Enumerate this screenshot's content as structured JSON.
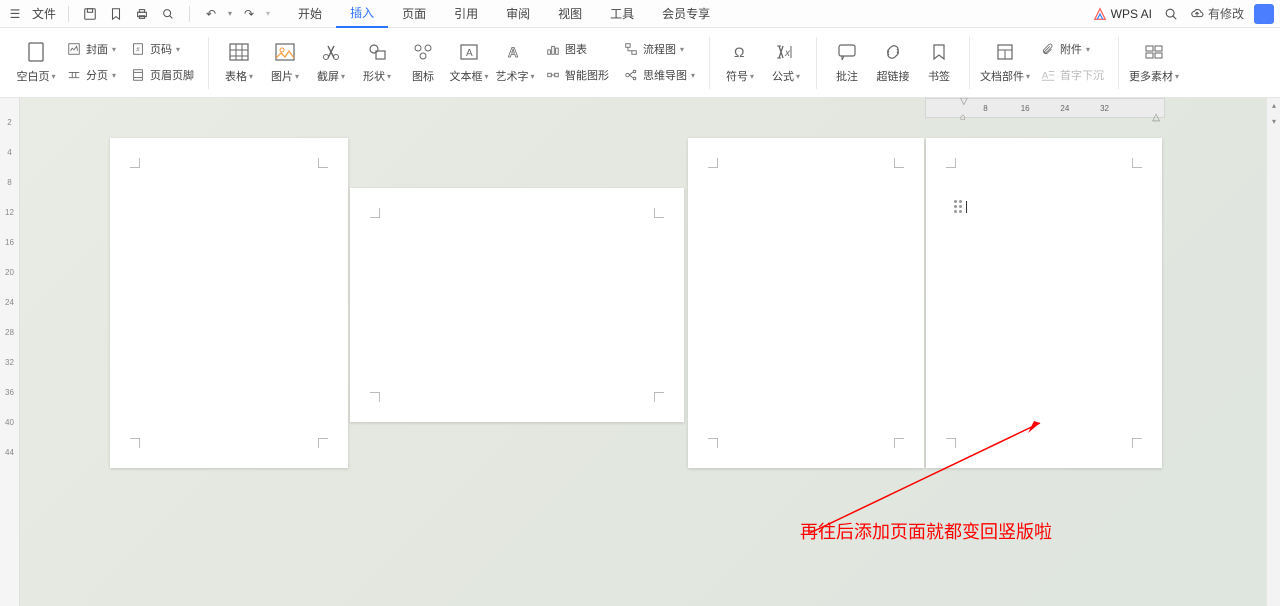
{
  "menubar": {
    "file": "文件",
    "tabs": [
      "开始",
      "插入",
      "页面",
      "引用",
      "审阅",
      "视图",
      "工具",
      "会员专享"
    ],
    "active_tab_index": 1,
    "wps_ai": "WPS AI",
    "status": "有修改"
  },
  "ribbon": {
    "blank_page": "空白页",
    "cover": "封面",
    "page_number": "页码",
    "page_break": "分页",
    "header_footer": "页眉页脚",
    "table": "表格",
    "picture": "图片",
    "screenshot": "截屏",
    "shapes": "形状",
    "icons": "图标",
    "textbox": "文本框",
    "wordart": "艺术字",
    "chart": "图表",
    "flowchart": "流程图",
    "smart_graphic": "智能图形",
    "mindmap": "思维导图",
    "symbol": "符号",
    "equation": "公式",
    "comment": "批注",
    "hyperlink": "超链接",
    "bookmark": "书签",
    "doc_parts": "文档部件",
    "dropcap": "首字下沉",
    "attachment": "附件",
    "more_assets": "更多素材"
  },
  "ruler": {
    "ticks": [
      "8",
      "16",
      "24",
      "32"
    ]
  },
  "v_ruler": [
    "2",
    "4",
    "8",
    "12",
    "16",
    "20",
    "24",
    "28",
    "32",
    "36",
    "40",
    "44"
  ],
  "annotation": "再往后添加页面就都变回竖版啦"
}
